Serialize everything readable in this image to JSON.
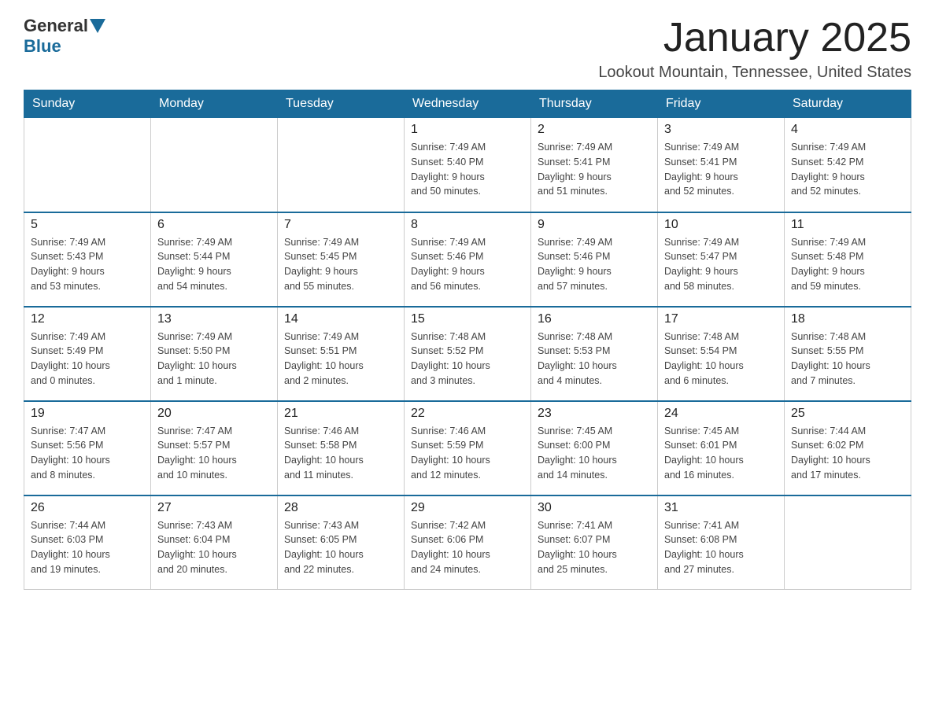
{
  "logo": {
    "general": "General",
    "blue": "Blue"
  },
  "header": {
    "month_year": "January 2025",
    "location": "Lookout Mountain, Tennessee, United States"
  },
  "weekdays": [
    "Sunday",
    "Monday",
    "Tuesday",
    "Wednesday",
    "Thursday",
    "Friday",
    "Saturday"
  ],
  "weeks": [
    [
      {
        "day": "",
        "info": ""
      },
      {
        "day": "",
        "info": ""
      },
      {
        "day": "",
        "info": ""
      },
      {
        "day": "1",
        "info": "Sunrise: 7:49 AM\nSunset: 5:40 PM\nDaylight: 9 hours\nand 50 minutes."
      },
      {
        "day": "2",
        "info": "Sunrise: 7:49 AM\nSunset: 5:41 PM\nDaylight: 9 hours\nand 51 minutes."
      },
      {
        "day": "3",
        "info": "Sunrise: 7:49 AM\nSunset: 5:41 PM\nDaylight: 9 hours\nand 52 minutes."
      },
      {
        "day": "4",
        "info": "Sunrise: 7:49 AM\nSunset: 5:42 PM\nDaylight: 9 hours\nand 52 minutes."
      }
    ],
    [
      {
        "day": "5",
        "info": "Sunrise: 7:49 AM\nSunset: 5:43 PM\nDaylight: 9 hours\nand 53 minutes."
      },
      {
        "day": "6",
        "info": "Sunrise: 7:49 AM\nSunset: 5:44 PM\nDaylight: 9 hours\nand 54 minutes."
      },
      {
        "day": "7",
        "info": "Sunrise: 7:49 AM\nSunset: 5:45 PM\nDaylight: 9 hours\nand 55 minutes."
      },
      {
        "day": "8",
        "info": "Sunrise: 7:49 AM\nSunset: 5:46 PM\nDaylight: 9 hours\nand 56 minutes."
      },
      {
        "day": "9",
        "info": "Sunrise: 7:49 AM\nSunset: 5:46 PM\nDaylight: 9 hours\nand 57 minutes."
      },
      {
        "day": "10",
        "info": "Sunrise: 7:49 AM\nSunset: 5:47 PM\nDaylight: 9 hours\nand 58 minutes."
      },
      {
        "day": "11",
        "info": "Sunrise: 7:49 AM\nSunset: 5:48 PM\nDaylight: 9 hours\nand 59 minutes."
      }
    ],
    [
      {
        "day": "12",
        "info": "Sunrise: 7:49 AM\nSunset: 5:49 PM\nDaylight: 10 hours\nand 0 minutes."
      },
      {
        "day": "13",
        "info": "Sunrise: 7:49 AM\nSunset: 5:50 PM\nDaylight: 10 hours\nand 1 minute."
      },
      {
        "day": "14",
        "info": "Sunrise: 7:49 AM\nSunset: 5:51 PM\nDaylight: 10 hours\nand 2 minutes."
      },
      {
        "day": "15",
        "info": "Sunrise: 7:48 AM\nSunset: 5:52 PM\nDaylight: 10 hours\nand 3 minutes."
      },
      {
        "day": "16",
        "info": "Sunrise: 7:48 AM\nSunset: 5:53 PM\nDaylight: 10 hours\nand 4 minutes."
      },
      {
        "day": "17",
        "info": "Sunrise: 7:48 AM\nSunset: 5:54 PM\nDaylight: 10 hours\nand 6 minutes."
      },
      {
        "day": "18",
        "info": "Sunrise: 7:48 AM\nSunset: 5:55 PM\nDaylight: 10 hours\nand 7 minutes."
      }
    ],
    [
      {
        "day": "19",
        "info": "Sunrise: 7:47 AM\nSunset: 5:56 PM\nDaylight: 10 hours\nand 8 minutes."
      },
      {
        "day": "20",
        "info": "Sunrise: 7:47 AM\nSunset: 5:57 PM\nDaylight: 10 hours\nand 10 minutes."
      },
      {
        "day": "21",
        "info": "Sunrise: 7:46 AM\nSunset: 5:58 PM\nDaylight: 10 hours\nand 11 minutes."
      },
      {
        "day": "22",
        "info": "Sunrise: 7:46 AM\nSunset: 5:59 PM\nDaylight: 10 hours\nand 12 minutes."
      },
      {
        "day": "23",
        "info": "Sunrise: 7:45 AM\nSunset: 6:00 PM\nDaylight: 10 hours\nand 14 minutes."
      },
      {
        "day": "24",
        "info": "Sunrise: 7:45 AM\nSunset: 6:01 PM\nDaylight: 10 hours\nand 16 minutes."
      },
      {
        "day": "25",
        "info": "Sunrise: 7:44 AM\nSunset: 6:02 PM\nDaylight: 10 hours\nand 17 minutes."
      }
    ],
    [
      {
        "day": "26",
        "info": "Sunrise: 7:44 AM\nSunset: 6:03 PM\nDaylight: 10 hours\nand 19 minutes."
      },
      {
        "day": "27",
        "info": "Sunrise: 7:43 AM\nSunset: 6:04 PM\nDaylight: 10 hours\nand 20 minutes."
      },
      {
        "day": "28",
        "info": "Sunrise: 7:43 AM\nSunset: 6:05 PM\nDaylight: 10 hours\nand 22 minutes."
      },
      {
        "day": "29",
        "info": "Sunrise: 7:42 AM\nSunset: 6:06 PM\nDaylight: 10 hours\nand 24 minutes."
      },
      {
        "day": "30",
        "info": "Sunrise: 7:41 AM\nSunset: 6:07 PM\nDaylight: 10 hours\nand 25 minutes."
      },
      {
        "day": "31",
        "info": "Sunrise: 7:41 AM\nSunset: 6:08 PM\nDaylight: 10 hours\nand 27 minutes."
      },
      {
        "day": "",
        "info": ""
      }
    ]
  ]
}
